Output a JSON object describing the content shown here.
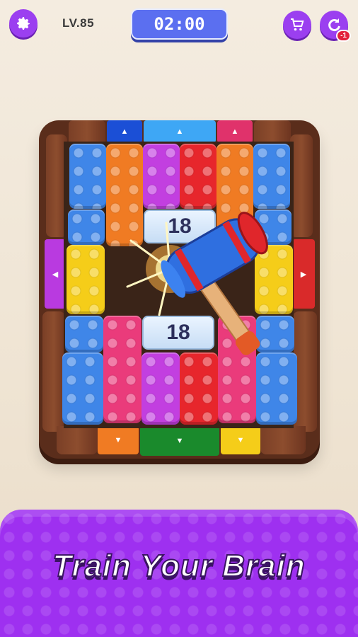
{
  "topbar": {
    "settings_icon": "gear-icon",
    "level_label": "LV.85",
    "timer": "02:00",
    "shop_icon": "cart-icon",
    "restart_icon": "refresh-icon",
    "restart_badge": "-1"
  },
  "board": {
    "tiles": [
      {
        "id": "tile-top",
        "value": "18"
      },
      {
        "id": "tile-bottom",
        "value": "18"
      }
    ],
    "colors": {
      "blue": "#3f86e8",
      "orange": "#f07b23",
      "purple": "#c23fe0",
      "red": "#e7262c",
      "yellow": "#f5cd19",
      "pink": "#ea3b7b",
      "green": "#1a8a2c"
    },
    "tool_icon": "hammer-icon"
  },
  "banner": {
    "title": "Train Your Brain"
  }
}
